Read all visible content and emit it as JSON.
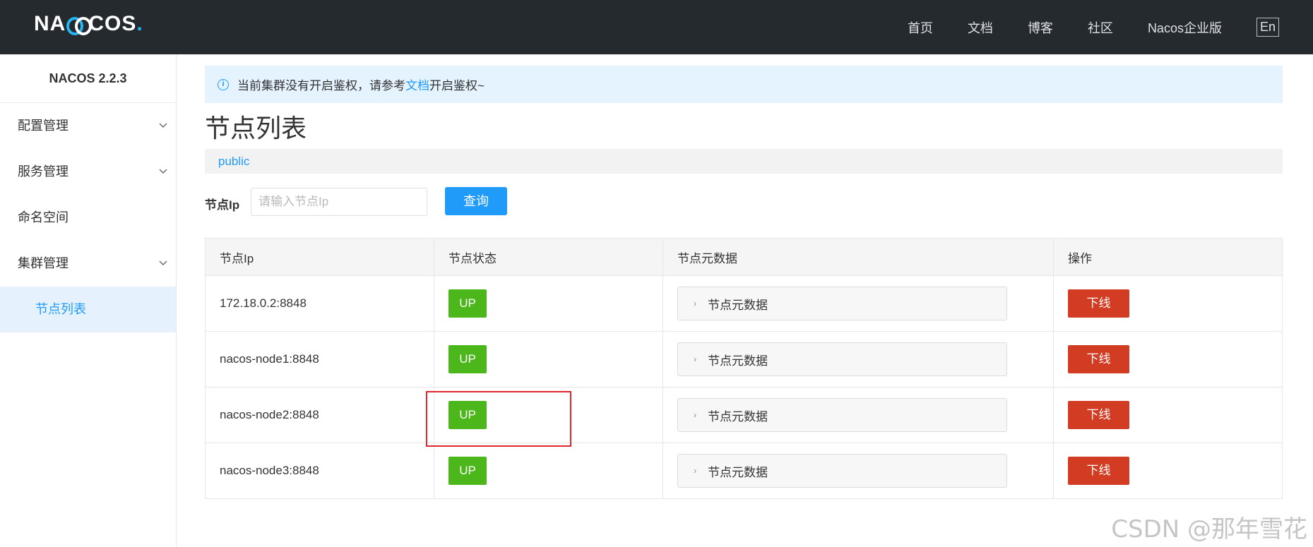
{
  "header": {
    "logo_prefix": "NA",
    "logo_suffix": "COS",
    "logo_dot": ".",
    "nav": [
      "首页",
      "文档",
      "博客",
      "社区",
      "Nacos企业版"
    ],
    "lang_toggle": "En"
  },
  "sidebar": {
    "version": "NACOS 2.2.3",
    "items": [
      {
        "label": "配置管理",
        "expandable": true
      },
      {
        "label": "服务管理",
        "expandable": true
      },
      {
        "label": "命名空间",
        "expandable": false
      },
      {
        "label": "集群管理",
        "expandable": true
      }
    ],
    "active_sub": "节点列表"
  },
  "alert": {
    "text_before": "当前集群没有开启鉴权，请参考",
    "link": "文档",
    "text_after": "开启鉴权~"
  },
  "page_title": "节点列表",
  "namespace": "public",
  "search": {
    "label": "节点Ip",
    "placeholder": "请输入节点Ip",
    "value": "",
    "button": "查询"
  },
  "table": {
    "headers": [
      "节点Ip",
      "节点状态",
      "节点元数据",
      "操作"
    ],
    "rows": [
      {
        "ip": "172.18.0.2:8848",
        "status": "UP",
        "meta": "节点元数据",
        "action": "下线"
      },
      {
        "ip": "nacos-node1:8848",
        "status": "UP",
        "meta": "节点元数据",
        "action": "下线"
      },
      {
        "ip": "nacos-node2:8848",
        "status": "UP",
        "meta": "节点元数据",
        "action": "下线"
      },
      {
        "ip": "nacos-node3:8848",
        "status": "UP",
        "meta": "节点元数据",
        "action": "下线"
      }
    ]
  },
  "watermark": "CSDN @那年雪花",
  "colors": {
    "header_bg": "#252a2f",
    "primary": "#209bfa",
    "up_green": "#4bb71a",
    "offline_red": "#d23c22",
    "highlight_red": "#e0272f"
  }
}
